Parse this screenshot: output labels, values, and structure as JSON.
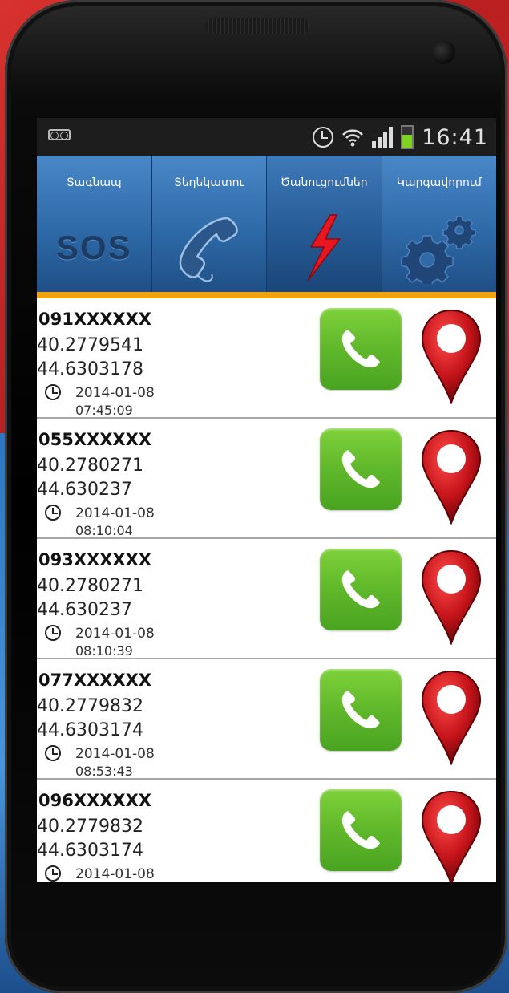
{
  "status_bar": {
    "clock": "16:41"
  },
  "tabs": [
    {
      "label": "Տագնապ",
      "icon": "sos-icon",
      "icon_text": "SOS"
    },
    {
      "label": "Տեղեկատու",
      "icon": "phone-handset-icon"
    },
    {
      "label": "Ծանուցումներ",
      "icon": "lightning-icon"
    },
    {
      "label": "Կարգավորում",
      "icon": "gears-icon"
    }
  ],
  "colors": {
    "accent": "#f2a20c",
    "tab_bg": "#2e6aa8",
    "call_green": "#5fb82a",
    "pin_red": "#c4141a"
  },
  "alerts": [
    {
      "phone": "091XXXXXX",
      "lat": "40.2779541",
      "lon": "44.6303178",
      "date": "2014-01-08",
      "time": "07:45:09"
    },
    {
      "phone": "055XXXXXX",
      "lat": "40.2780271",
      "lon": "44.630237",
      "date": "2014-01-08",
      "time": "08:10:04"
    },
    {
      "phone": "093XXXXXX",
      "lat": "40.2780271",
      "lon": "44.630237",
      "date": "2014-01-08",
      "time": "08:10:39"
    },
    {
      "phone": "077XXXXXX",
      "lat": "40.2779832",
      "lon": "44.6303174",
      "date": "2014-01-08",
      "time": "08:53:43"
    },
    {
      "phone": "096XXXXXX",
      "lat": "40.2779832",
      "lon": "44.6303174",
      "date": "2014-01-08",
      "time": ""
    }
  ]
}
